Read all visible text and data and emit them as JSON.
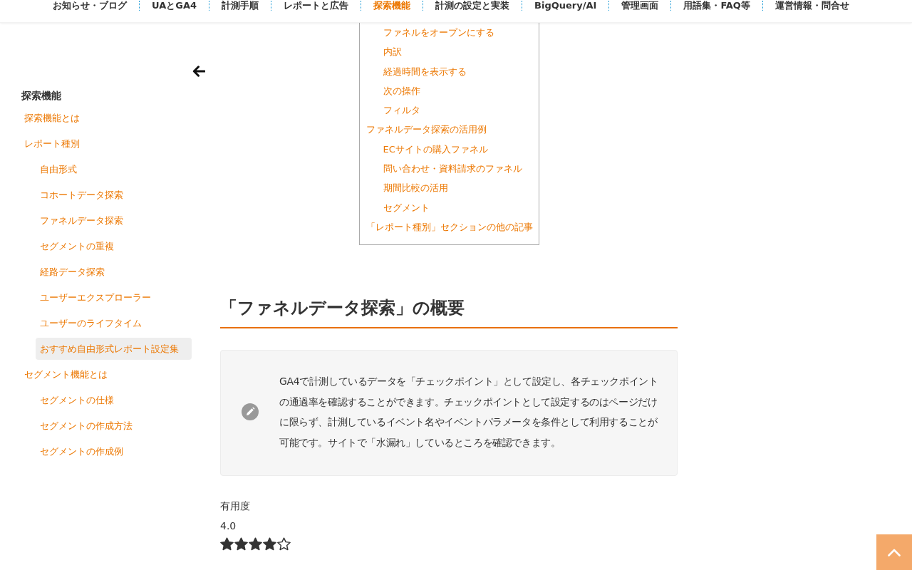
{
  "nav": {
    "items": [
      {
        "label": "お知らせ・ブログ",
        "selected": false
      },
      {
        "label": "UAとGA4",
        "selected": false
      },
      {
        "label": "計測手順",
        "selected": false
      },
      {
        "label": "レポートと広告",
        "selected": false
      },
      {
        "label": "探索機能",
        "selected": true
      },
      {
        "label": "計測の設定と実装",
        "selected": false
      },
      {
        "label": "BigQuery/AI",
        "selected": false
      },
      {
        "label": "管理画面",
        "selected": false
      },
      {
        "label": "用語集・FAQ等",
        "selected": false
      },
      {
        "label": "運営情報・問合せ",
        "selected": false
      }
    ]
  },
  "sidebar": {
    "title": "探索機能",
    "items": [
      {
        "label": "探索機能とは",
        "selected": false
      },
      {
        "label": "レポート種別",
        "selected": false,
        "children": [
          {
            "label": "自由形式",
            "selected": false
          },
          {
            "label": "コホートデータ探索",
            "selected": false
          },
          {
            "label": "ファネルデータ探索",
            "selected": false
          },
          {
            "label": "セグメントの重複",
            "selected": false
          },
          {
            "label": "経路データ探索",
            "selected": false
          },
          {
            "label": "ユーザーエクスプローラー",
            "selected": false
          },
          {
            "label": "ユーザーのライフタイム",
            "selected": false
          },
          {
            "label": "おすすめ自由形式レポート設定集",
            "selected": true
          }
        ]
      },
      {
        "label": "セグメント機能とは",
        "selected": false,
        "children": [
          {
            "label": "セグメントの仕様",
            "selected": false
          },
          {
            "label": "セグメントの作成方法",
            "selected": false
          },
          {
            "label": "セグメントの作成例",
            "selected": false
          }
        ]
      }
    ]
  },
  "toc": {
    "continued_children": [
      "ファネルをオープンにする",
      "内訳",
      "経過時間を表示する",
      "次の操作",
      "フィルタ"
    ],
    "items": [
      {
        "label": "ファネルデータ探索の活用例",
        "children": [
          "ECサイトの購入ファネル",
          "問い合わせ・資料請求のファネル",
          "期間比較の活用",
          "セグメント"
        ]
      },
      {
        "label": "「レポート種別」セクションの他の記事"
      }
    ]
  },
  "section": {
    "heading": "「ファネルデータ探索」の概要",
    "note": "GA4で計測しているデータを「チェックポイント」として設定し、各チェックポイントの通過率を確認することができます。チェックポイントとして設定するのはページだけに限らず、計測しているイベント名やイベントパラメータを条件として利用することが可能です。サイトで「水漏れ」しているところを確認できます。"
  },
  "rating": {
    "label": "有用度",
    "value": "4.0",
    "stars": 4
  }
}
